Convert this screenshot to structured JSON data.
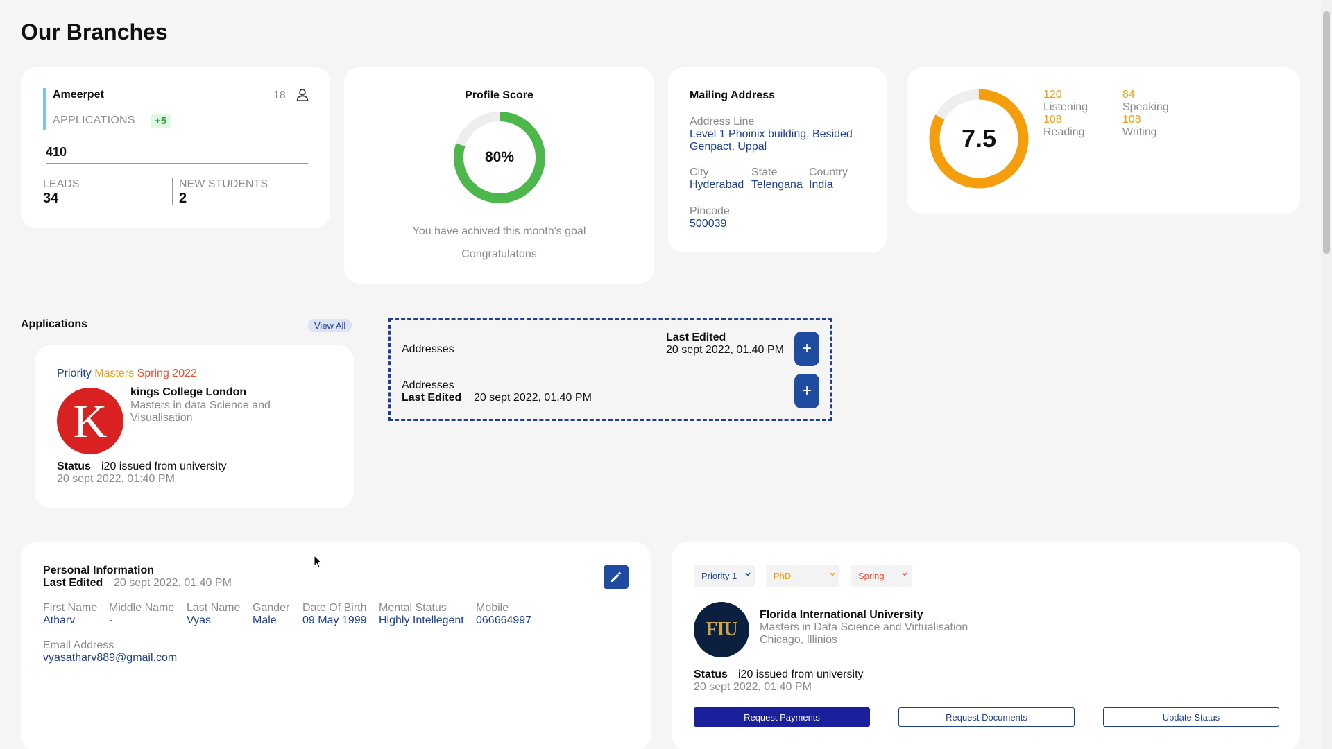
{
  "page": {
    "title": "Our Branches"
  },
  "branch": {
    "name": "Ameerpet",
    "count": "18",
    "applications_label": "APPLICATIONS",
    "applications_delta": "+5",
    "applications_total": "410",
    "leads_label": "LEADS",
    "leads_value": "34",
    "new_students_label": "NEW STUDENTS",
    "new_students_value": "2"
  },
  "profile_score": {
    "title": "Profile Score",
    "percent": 80,
    "percent_label": "80%",
    "message": "You have achived this month's goal",
    "congrats": "Congratulatons",
    "ring_color": "#4cb84c"
  },
  "mailing": {
    "title": "Mailing Address",
    "address_line_label": "Address Line",
    "address_line_1": "Level 1 Phoinix building, Besided",
    "address_line_2": "Genpact, Uppal",
    "city_label": "City",
    "city": "Hyderabad",
    "state_label": "State",
    "state": "Telengana",
    "country_label": "Country",
    "country": "India",
    "pincode_label": "Pincode",
    "pincode": "500039"
  },
  "test_score": {
    "overall": "7.5",
    "ring_fraction": 0.83,
    "ring_color": "#f59e0b",
    "listening_value": "120",
    "listening_label": "Listening",
    "speaking_value": "84",
    "speaking_label": "Speaking",
    "reading_value": "108",
    "reading_label": "Reading",
    "writing_value": "108",
    "writing_label": "Writing"
  },
  "applications": {
    "heading": "Applications",
    "view_all": "View All",
    "card": {
      "priority": "Priority",
      "degree": "Masters",
      "term": "Spring 2022",
      "logo_letter": "K",
      "university": "kings College London",
      "course": "Masters in data Science and Visualisation",
      "status_label": "Status",
      "status": "i20 issued from university",
      "date": "20 sept 2022, 01:40 PM"
    }
  },
  "addresses": {
    "row1_label": "Addresses",
    "row1_edited_label": "Last Edited",
    "row1_edited_value": "20 sept 2022, 01.40 PM",
    "row2_label": "Addresses",
    "row2_edited_label": "Last Edited",
    "row2_edited_value": "20 sept 2022, 01.40 PM",
    "plus": "+"
  },
  "personal": {
    "title": "Personal Information",
    "edited_label": "Last Edited",
    "edited_value": "20 sept 2022, 01.40 PM",
    "fields": {
      "first_name_label": "First Name",
      "first_name": "Atharv",
      "middle_name_label": "Middle Name",
      "middle_name": "-",
      "last_name_label": "Last Name",
      "last_name": "Vyas",
      "gender_label": "Gander",
      "gender": "Male",
      "dob_label": "Date Of Birth",
      "dob": "09 May 1999",
      "mental_label": "Mental Status",
      "mental": "Highly Intellegent",
      "mobile_label": "Mobile",
      "mobile": "066664997",
      "email_label": "Email Address",
      "email": "vyasatharv889@gmail.com"
    }
  },
  "university": {
    "priority_select": "Priority 1",
    "degree_select": "PhD",
    "term_select": "Spring",
    "logo_text": "FIU",
    "name": "Florida International University",
    "course": "Masters in Data Science and Virtualisation",
    "location": "Chicago, Illinios",
    "status_label": "Status",
    "status": "i20 issued from university",
    "date": "20 sept 2022, 01:40 PM",
    "btn_payments": "Request Payments",
    "btn_documents": "Request Documents",
    "btn_status": "Update Status"
  }
}
